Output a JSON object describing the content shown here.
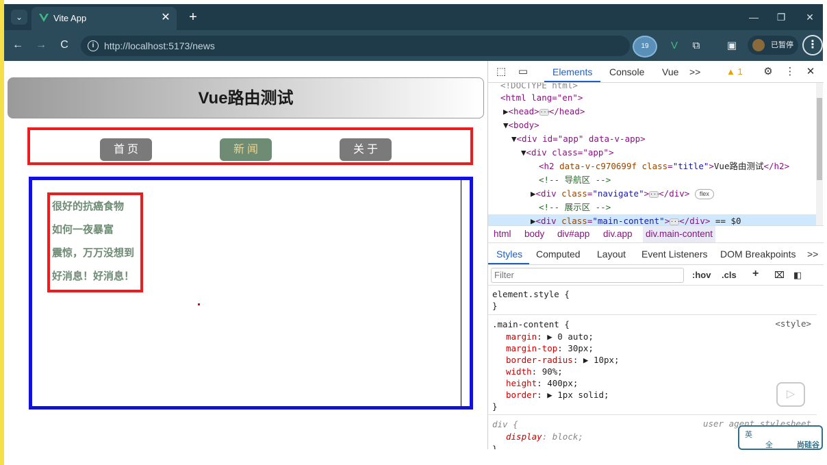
{
  "browser": {
    "tab_title": "Vite App",
    "url_host": "http://localhost",
    "url_rest": ":5173/news",
    "paused_label": "已暂停",
    "ext_badge": "19"
  },
  "page": {
    "title": "Vue路由测试",
    "nav": [
      {
        "label": "首页",
        "active": false
      },
      {
        "label": "新闻",
        "active": true
      },
      {
        "label": "关于",
        "active": false
      }
    ],
    "news_items": [
      "很好的抗癌食物",
      "如何一夜暴富",
      "震惊，万万没想到",
      "好消息！好消息！"
    ]
  },
  "devtools": {
    "tabs": [
      "Elements",
      "Console",
      "Vue"
    ],
    "warning_count": "1",
    "dom": [
      "<!DOCTYPE html>",
      "<html lang=\"en\">",
      "<head>",
      "</head>",
      "<body>",
      "<div id=\"app\" data-v-app>",
      "<div class=\"app\">",
      "Vue路由测试",
      "<!-- 导航区 -->",
      "flex",
      "<!-- 展示区 -->",
      "== $0"
    ],
    "breadcrumbs": [
      "html",
      "body",
      "div#app",
      "div.app",
      "div.main-content"
    ],
    "subtabs": [
      "Styles",
      "Computed",
      "Layout",
      "Event Listeners",
      "DOM Breakpoints"
    ],
    "filter_placeholder": "Filter",
    "hov": ":hov",
    "cls": ".cls",
    "element_style": "element.style {",
    "rule_selector": ".main-content {",
    "rule_source": "<style>",
    "props": [
      {
        "name": "margin",
        "value": "▶ 0 auto;"
      },
      {
        "name": "margin-top",
        "value": "30px;"
      },
      {
        "name": "border-radius",
        "value": "▶ 10px;"
      },
      {
        "name": "width",
        "value": "90%;"
      },
      {
        "name": "height",
        "value": "400px;"
      },
      {
        "name": "border",
        "value": "▶ 1px solid;"
      }
    ],
    "ua_selector": "div {",
    "ua_source": "user agent stylesheet",
    "ua_prop": {
      "name": "display",
      "value": "block;"
    }
  },
  "ime": {
    "label1": "英",
    "label2": "全",
    "brand": "尚硅谷"
  }
}
